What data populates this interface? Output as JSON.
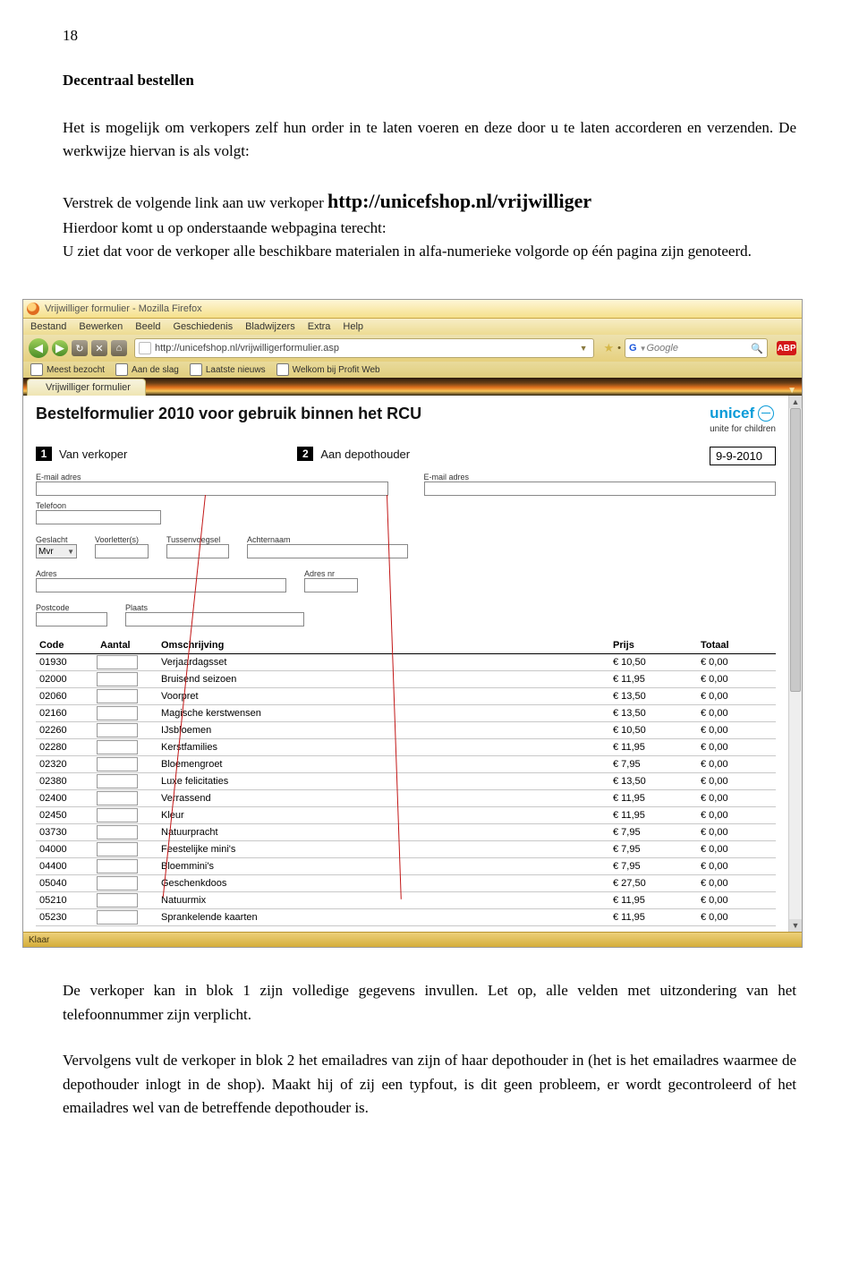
{
  "page_number": "18",
  "heading": "Decentraal bestellen",
  "para1": "Het is mogelijk om verkopers zelf hun order in te laten voeren en deze door u te laten accorderen en verzenden. De werkwijze hiervan is als volgt:",
  "para2_pre": "Verstrek de volgende link aan uw verkoper ",
  "url_big": "http://unicefshop.nl/vrijwilliger",
  "para3": "Hierdoor komt u op onderstaande webpagina terecht:",
  "para4": "U ziet dat voor de verkoper alle beschikbare materialen in alfa-numerieke volgorde op één pagina zijn genoteerd.",
  "para_bottom1": "De verkoper kan in blok 1 zijn volledige gegevens invullen. Let op, alle velden met uitzondering van het telefoonnummer zijn verplicht.",
  "para_bottom2": "Vervolgens vult de verkoper in blok 2 het emailadres van zijn of haar depothouder in (het is het emailadres waarmee de depothouder inlogt in de shop). Maakt hij of zij een typfout, is dit geen probleem, er wordt gecontroleerd of het emailadres wel van de betreffende depothouder is.",
  "browser": {
    "window_title": "Vrijwilliger formulier - Mozilla Firefox",
    "menus": [
      "Bestand",
      "Bewerken",
      "Beeld",
      "Geschiedenis",
      "Bladwijzers",
      "Extra",
      "Help"
    ],
    "url": "http://unicefshop.nl/vrijwilligerformulier.asp",
    "search_placeholder": "Google",
    "bookmarks": [
      "Meest bezocht",
      "Aan de slag",
      "Laatste nieuws",
      "Welkom bij Profit Web"
    ],
    "tab_label": "Vrijwilliger formulier",
    "status": "Klaar",
    "abp": "ABP"
  },
  "form": {
    "title": "Bestelformulier 2010 voor gebruik binnen het RCU",
    "unicef": "unicef",
    "unicef_sub": "unite for children",
    "step1": "1",
    "step1_label": "Van verkoper",
    "step2": "2",
    "step2_label": "Aan depothouder",
    "date": "9-9-2010",
    "labels": {
      "email": "E-mail adres",
      "telefoon": "Telefoon",
      "geslacht": "Geslacht",
      "voorletters": "Voorletter(s)",
      "tussen": "Tussenvoegsel",
      "achternaam": "Achternaam",
      "adres": "Adres",
      "adresnr": "Adres nr",
      "postcode": "Postcode",
      "plaats": "Plaats"
    },
    "geslacht_value": "Mvr",
    "table_headers": {
      "code": "Code",
      "aantal": "Aantal",
      "oms": "Omschrijving",
      "prijs": "Prijs",
      "totaal": "Totaal"
    },
    "rows": [
      {
        "code": "01930",
        "oms": "Verjaardagsset",
        "prijs": "€ 10,50",
        "totaal": "€ 0,00"
      },
      {
        "code": "02000",
        "oms": "Bruisend seizoen",
        "prijs": "€ 11,95",
        "totaal": "€ 0,00"
      },
      {
        "code": "02060",
        "oms": "Voorpret",
        "prijs": "€ 13,50",
        "totaal": "€ 0,00"
      },
      {
        "code": "02160",
        "oms": "Magische kerstwensen",
        "prijs": "€ 13,50",
        "totaal": "€ 0,00"
      },
      {
        "code": "02260",
        "oms": "IJsbloemen",
        "prijs": "€ 10,50",
        "totaal": "€ 0,00"
      },
      {
        "code": "02280",
        "oms": "Kerstfamilies",
        "prijs": "€ 11,95",
        "totaal": "€ 0,00"
      },
      {
        "code": "02320",
        "oms": "Bloemengroet",
        "prijs": "€ 7,95",
        "totaal": "€ 0,00"
      },
      {
        "code": "02380",
        "oms": "Luxe felicitaties",
        "prijs": "€ 13,50",
        "totaal": "€ 0,00"
      },
      {
        "code": "02400",
        "oms": "Verrassend",
        "prijs": "€ 11,95",
        "totaal": "€ 0,00"
      },
      {
        "code": "02450",
        "oms": "Kleur",
        "prijs": "€ 11,95",
        "totaal": "€ 0,00"
      },
      {
        "code": "03730",
        "oms": "Natuurpracht",
        "prijs": "€ 7,95",
        "totaal": "€ 0,00"
      },
      {
        "code": "04000",
        "oms": "Feestelijke mini's",
        "prijs": "€ 7,95",
        "totaal": "€ 0,00"
      },
      {
        "code": "04400",
        "oms": "Bloemmini's",
        "prijs": "€ 7,95",
        "totaal": "€ 0,00"
      },
      {
        "code": "05040",
        "oms": "Geschenkdoos",
        "prijs": "€ 27,50",
        "totaal": "€ 0,00"
      },
      {
        "code": "05210",
        "oms": "Natuurmix",
        "prijs": "€ 11,95",
        "totaal": "€ 0,00"
      },
      {
        "code": "05230",
        "oms": "Sprankelende kaarten",
        "prijs": "€ 11,95",
        "totaal": "€ 0,00"
      }
    ]
  }
}
